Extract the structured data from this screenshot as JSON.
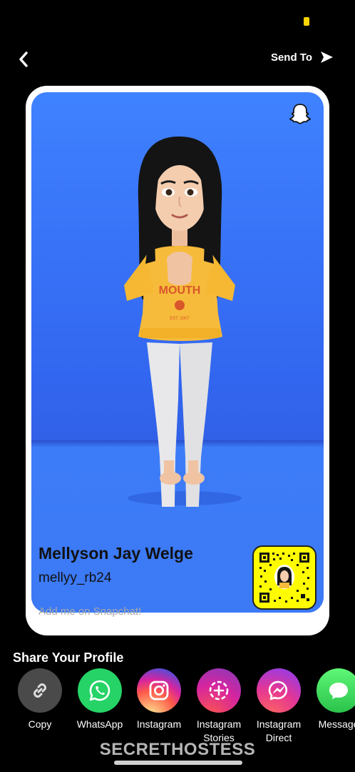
{
  "header": {
    "send_to_label": "Send To"
  },
  "profile": {
    "display_name": "Mellyson Jay Welge",
    "username": "mellyy_rb24",
    "add_me_text": "Add me on Snapchat!"
  },
  "share": {
    "title": "Share Your Profile",
    "items": [
      {
        "label": "Copy",
        "icon": "link-icon",
        "color": "#4a4a4a"
      },
      {
        "label": "WhatsApp",
        "icon": "whatsapp-icon",
        "color": "#25d366"
      },
      {
        "label": "Instagram",
        "icon": "instagram-icon",
        "color": "#d6249f"
      },
      {
        "label": "Instagram Stories",
        "icon": "instagram-stories-icon",
        "color": "#c13584"
      },
      {
        "label": "Instagram Direct",
        "icon": "instagram-direct-icon",
        "color": "#a334fa"
      },
      {
        "label": "Message",
        "icon": "message-icon",
        "color": "#34c759"
      }
    ]
  },
  "watermark": "SECRETHOSTESS",
  "colors": {
    "snap_yellow": "#fffc00",
    "card_blue": "#3a74f6"
  }
}
